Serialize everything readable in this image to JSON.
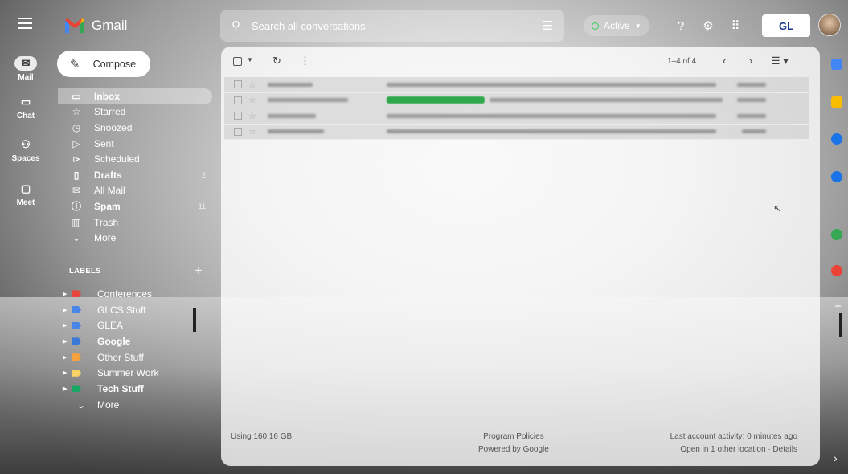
{
  "app": {
    "name": "Gmail"
  },
  "rail": [
    {
      "label": "Mail",
      "icon": "mail-icon",
      "active": true
    },
    {
      "label": "Chat",
      "icon": "chat-icon",
      "active": false
    },
    {
      "label": "Spaces",
      "icon": "spaces-icon",
      "active": false
    },
    {
      "label": "Meet",
      "icon": "meet-icon",
      "active": false
    }
  ],
  "search": {
    "placeholder": "Search all conversations"
  },
  "status": {
    "label": "Active",
    "color": "#34d058"
  },
  "account": {
    "badge": "GL"
  },
  "compose": {
    "label": "Compose"
  },
  "nav": [
    {
      "label": "Inbox",
      "icon": "inbox-icon",
      "bold": true,
      "active": true,
      "count": ""
    },
    {
      "label": "Starred",
      "icon": "star-icon",
      "bold": false,
      "active": false,
      "count": ""
    },
    {
      "label": "Snoozed",
      "icon": "clock-icon",
      "bold": false,
      "active": false,
      "count": ""
    },
    {
      "label": "Sent",
      "icon": "send-icon",
      "bold": false,
      "active": false,
      "count": ""
    },
    {
      "label": "Scheduled",
      "icon": "scheduled-icon",
      "bold": false,
      "active": false,
      "count": ""
    },
    {
      "label": "Drafts",
      "icon": "draft-icon",
      "bold": true,
      "active": false,
      "count": "2"
    },
    {
      "label": "All Mail",
      "icon": "all-mail-icon",
      "bold": false,
      "active": false,
      "count": ""
    },
    {
      "label": "Spam",
      "icon": "spam-icon",
      "bold": true,
      "active": false,
      "count": "11"
    },
    {
      "label": "Trash",
      "icon": "trash-icon",
      "bold": false,
      "active": false,
      "count": ""
    },
    {
      "label": "More",
      "icon": "chevron-down-icon",
      "bold": false,
      "active": false,
      "count": ""
    }
  ],
  "labels_heading": "LABELS",
  "labels": [
    {
      "label": "Conferences",
      "color": "#e8453c",
      "bold": false
    },
    {
      "label": "GLCS Stuff",
      "color": "#4a86e8",
      "bold": false
    },
    {
      "label": "GLEA",
      "color": "#4a86e8",
      "bold": false
    },
    {
      "label": "Google",
      "color": "#3c78d8",
      "bold": true
    },
    {
      "label": "Other Stuff",
      "color": "#f6a23c",
      "bold": false
    },
    {
      "label": "Summer Work",
      "color": "#fad165",
      "bold": false
    },
    {
      "label": "Tech Stuff",
      "color": "#16a765",
      "bold": true
    },
    {
      "label": "More",
      "color": "",
      "bold": false
    }
  ],
  "pager": {
    "range": "1–4 of 4"
  },
  "emails": [
    {
      "sender_w": 56,
      "subj_w": 410,
      "chip": false
    },
    {
      "sender_w": 100,
      "subj_w": 290,
      "chip": true
    },
    {
      "sender_w": 60,
      "subj_w": 410,
      "chip": false
    },
    {
      "sender_w": 70,
      "subj_w": 410,
      "chip": false
    }
  ],
  "footer": {
    "storage": "Using 160.16 GB",
    "policies": "Program Policies",
    "powered": "Powered by Google",
    "activity": "Last account activity: 0 minutes ago",
    "location": "Open in 1 other location · Details"
  },
  "side_panel": [
    {
      "icon": "calendar-icon",
      "color": "#4285f4"
    },
    {
      "icon": "keep-icon",
      "color": "#fbbc04"
    },
    {
      "icon": "tasks-icon",
      "color": "#1a73e8"
    },
    {
      "icon": "contacts-icon",
      "color": "#1a73e8"
    },
    {
      "icon": "addon-icon",
      "color": "#34a853"
    },
    {
      "icon": "addon-icon",
      "color": "#ea4335"
    }
  ]
}
